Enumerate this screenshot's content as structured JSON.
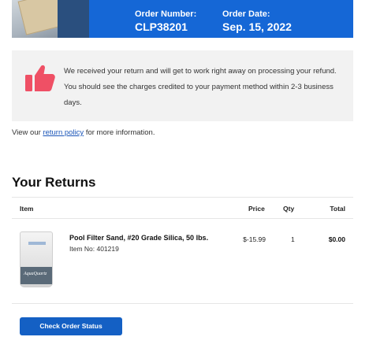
{
  "header": {
    "order_number_label": "Order Number:",
    "order_number": "CLP38201",
    "order_date_label": "Order Date:",
    "order_date": "Sep. 15, 2022",
    "colors": {
      "banner": "#1567d6",
      "highlight": "#f4e54a"
    }
  },
  "notice": {
    "icon": "thumbs-up-icon",
    "icon_color": "#ef5065",
    "message": "We received your return and will get to work right away on processing your refund. You should see the charges credited to your payment method within 2-3 business days."
  },
  "policy": {
    "prefix": "View our ",
    "link_text": "return policy",
    "suffix": " for more information."
  },
  "returns": {
    "title": "Your Returns",
    "columns": {
      "item": "Item",
      "price": "Price",
      "qty": "Qty",
      "total": "Total"
    },
    "items": [
      {
        "name": "Pool Filter Sand, #20 Grade Silica, 50 lbs.",
        "item_no": "Item No: 401219",
        "price": "$-15.99",
        "qty": "1",
        "total": "$0.00",
        "image_label": "AquaQuartz"
      }
    ]
  },
  "cta": {
    "label": "Check Order Status"
  }
}
